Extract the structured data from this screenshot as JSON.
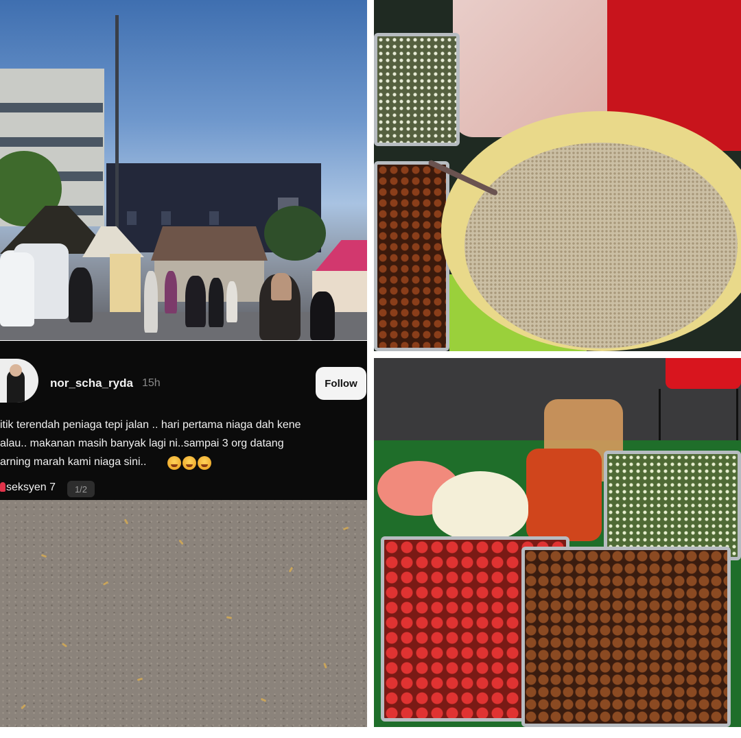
{
  "post": {
    "username": "nor_scha_ryda",
    "time": "15h",
    "follow_label": "Follow",
    "caption_lines": [
      "itik terendah peniaga tepi jalan .. hari pertama niaga dah kene",
      "alau.. makanan masih banyak lagi ni..sampai 3 org datang",
      "arning marah kami niaga sini.."
    ],
    "location": "seksyen 7",
    "pager": "1/2"
  },
  "colors": {
    "overlay_bg": "#0b0b0b",
    "follow_bg": "#f4f4f4",
    "sky": "#3f6fb0",
    "ground": "#8b837b"
  }
}
